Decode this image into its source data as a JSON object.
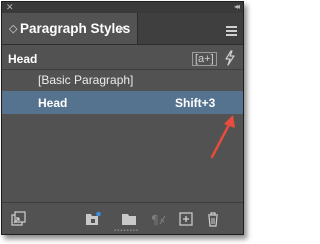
{
  "window": {
    "close_glyph": "✕",
    "collapse_glyph": "◂◂"
  },
  "tab": {
    "title": "Paragraph Styles",
    "close_glyph": "×",
    "icon": "expand-toggle-icon"
  },
  "header": {
    "current_style": "Head",
    "override_button": "[a+]",
    "lightning_icon": "lightning-icon"
  },
  "styles": [
    {
      "label": "[Basic Paragraph]",
      "shortcut": "",
      "selected": false
    },
    {
      "label": "Head",
      "shortcut": "Shift+3",
      "selected": true
    }
  ],
  "bottom_toolbar": {
    "icons": [
      "load-styles-icon",
      "new-group-icon",
      "folder-icon",
      "clear-overrides-icon",
      "new-style-icon",
      "delete-icon"
    ]
  },
  "colors": {
    "panel_bg": "#525252",
    "selection": "#55728f",
    "annotation_arrow": "#e74c3c"
  }
}
